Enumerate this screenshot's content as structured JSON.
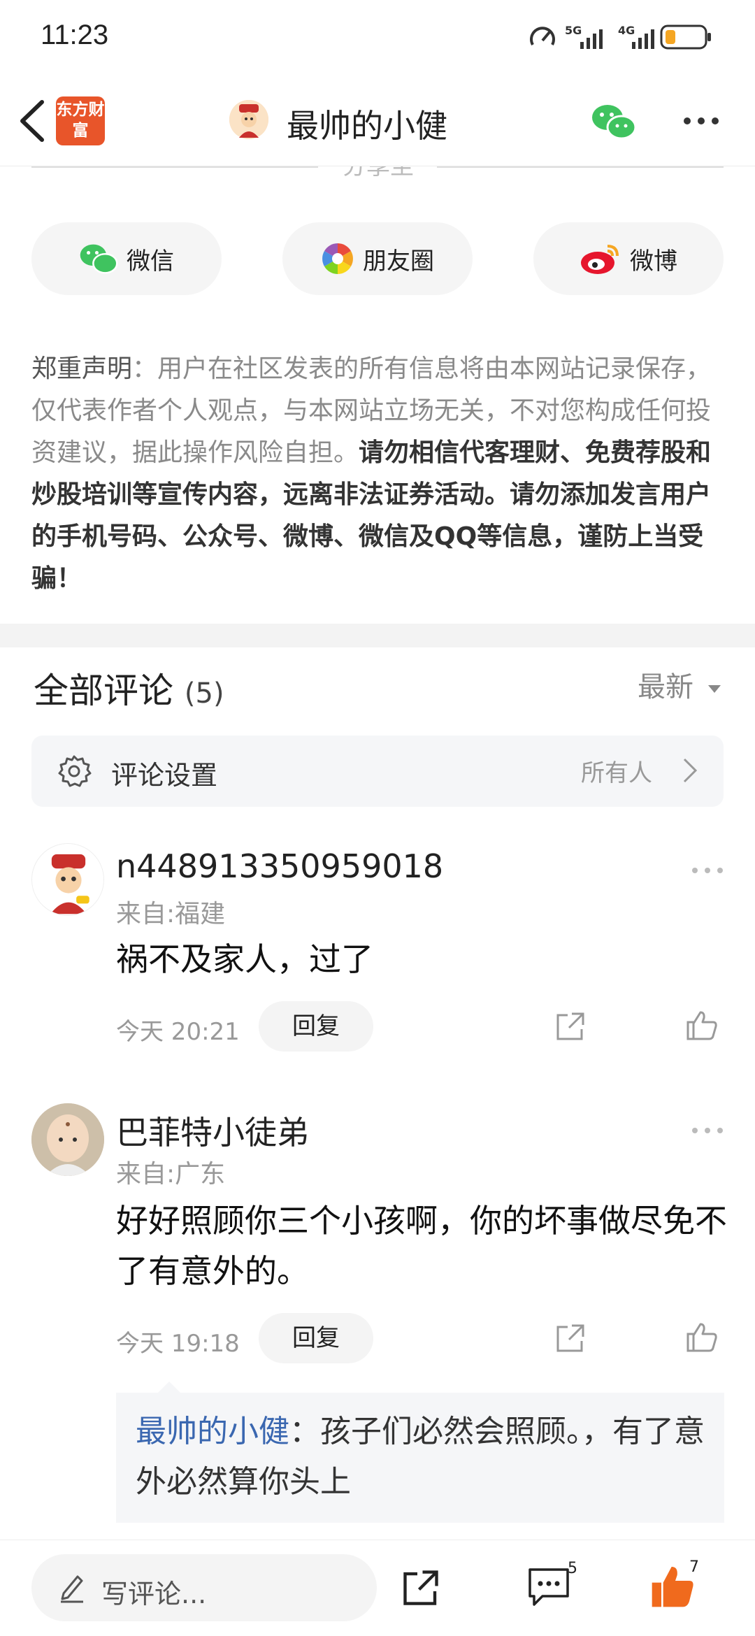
{
  "status": {
    "time": "11:23",
    "signal1": "5G",
    "signal2": "4G"
  },
  "nav": {
    "logo_text": "东方财富",
    "title": "最帅的小健"
  },
  "share": {
    "hint": "分享至",
    "wechat": "微信",
    "moments": "朋友圈",
    "weibo": "微博"
  },
  "disclaimer": {
    "label": "郑重声明",
    "normal": "：用户在社区发表的所有信息将由本网站记录保存，仅代表作者个人观点，与本网站立场无关，不对您构成任何投资建议，据此操作风险自担。",
    "bold": "请勿相信代客理财、免费荐股和炒股培训等宣传内容，远离非法证券活动。请勿添加发言用户的手机号码、公众号、微博、微信及QQ等信息，谨防上当受骗！"
  },
  "comments_header": {
    "title": "全部评论",
    "count": "(5)",
    "sort": "最新"
  },
  "settings": {
    "label": "评论设置",
    "value": "所有人"
  },
  "comments": [
    {
      "name": "n448913350959018",
      "location": "来自:福建",
      "text": "祸不及家人，过了",
      "time": "今天 20:21",
      "reply": "回复"
    },
    {
      "name": "巴菲特小徒弟",
      "location": "来自:广东",
      "text": "好好照顾你三个小孩啊，你的坏事做尽免不了有意外的。",
      "time": "今天 19:18",
      "reply": "回复"
    }
  ],
  "sub_reply": {
    "name": "最帅的小健",
    "text": "：孩子们必然会照顾。，有了意外必然算你头上"
  },
  "bottom": {
    "placeholder": "写评论...",
    "comment_count": "5",
    "like_count": "7"
  },
  "colors": {
    "accent": "#e8552a",
    "link": "#3a67b0",
    "like": "#f06a1d"
  }
}
